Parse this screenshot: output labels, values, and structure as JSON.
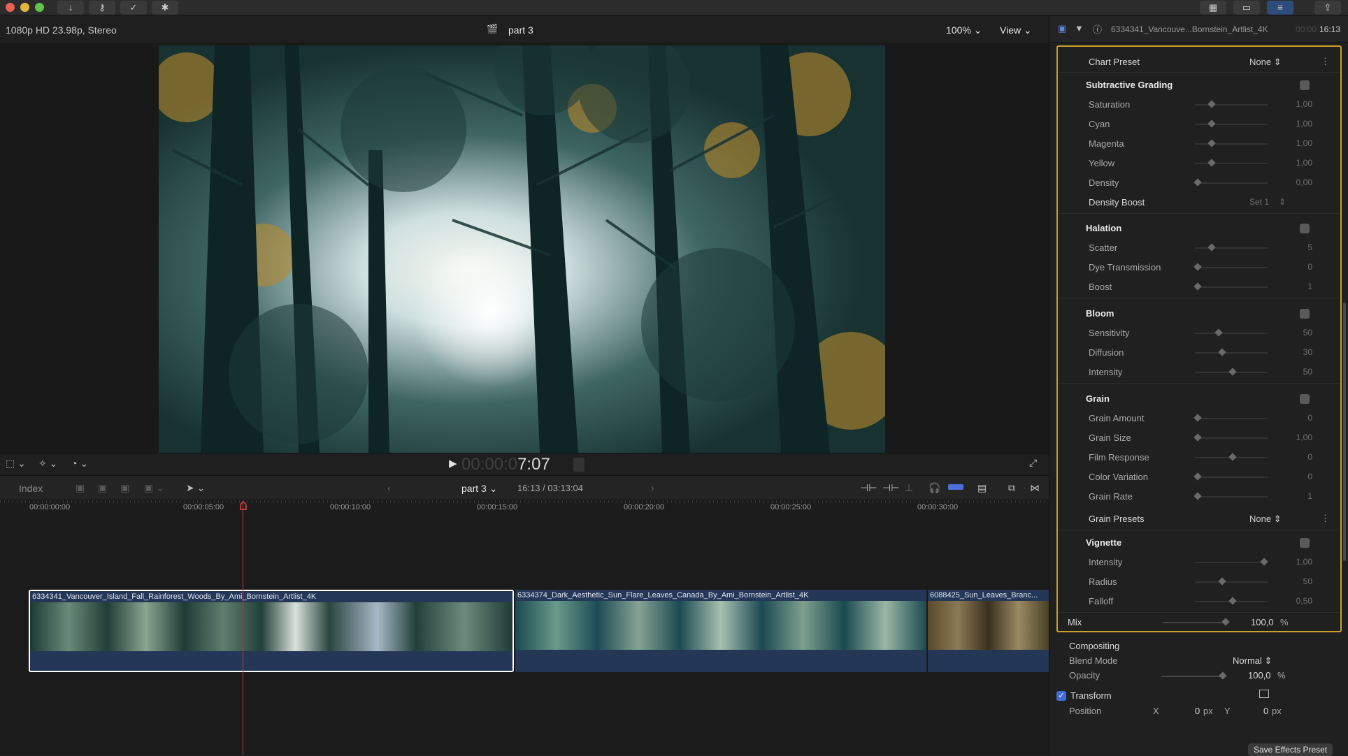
{
  "titlebar": {
    "icons": [
      "download-icon",
      "key-icon",
      "check-icon",
      "share-grid-icon"
    ],
    "right_icons": [
      "grid-view-icon",
      "filmstrip-icon",
      "inspector-toggle-icon",
      "export-icon"
    ]
  },
  "viewer": {
    "format": "1080p HD 23.98p, Stereo",
    "project": "part 3",
    "zoom": "100%",
    "view_label": "View"
  },
  "transport": {
    "timecode_dim": "00:00:0",
    "timecode_bright": "7:07"
  },
  "timeline_toolbar": {
    "index_label": "Index",
    "project": "part 3",
    "duration": "16:13 / 03:13:04"
  },
  "ruler": {
    "ticks": [
      "00:00:00:00",
      "00:00:05:00",
      "00:00:10:00",
      "00:00:15:00",
      "00:00:20:00",
      "00:00:25:00",
      "00:00:30:00"
    ]
  },
  "clips": [
    {
      "title": "6334341_Vancouver_Island_Fall_Rainforest_Woods_By_Ami_Bornstein_Artlist_4K",
      "selected": true
    },
    {
      "title": "6334374_Dark_Aesthetic_Sun_Flare_Leaves_Canada_By_Ami_Bornstein_Artlist_4K",
      "selected": false
    },
    {
      "title": "6088425_Sun_Leaves_Branc...",
      "selected": false
    }
  ],
  "inspector": {
    "clip_name": "6334341_Vancouve...Bornstein_Artlist_4K",
    "clip_time_dim": "00:00",
    "clip_time": "16:13",
    "chart_preset": {
      "label": "Chart Preset",
      "value": "None"
    },
    "subtractive": {
      "title": "Subtractive Grading",
      "params": [
        {
          "label": "Saturation",
          "value": "1,00",
          "level": 0.2
        },
        {
          "label": "Cyan",
          "value": "1,00",
          "level": 0.2
        },
        {
          "label": "Magenta",
          "value": "1,00",
          "level": 0.2
        },
        {
          "label": "Yellow",
          "value": "1,00",
          "level": 0.2
        },
        {
          "label": "Density",
          "value": "0,00",
          "level": 0.0
        }
      ],
      "density_boost": {
        "label": "Density Boost",
        "value": "Set 1"
      }
    },
    "halation": {
      "title": "Halation",
      "params": [
        {
          "label": "Scatter",
          "value": "5",
          "level": 0.2
        },
        {
          "label": "Dye Transmission",
          "value": "0",
          "level": 0.0
        },
        {
          "label": "Boost",
          "value": "1",
          "level": 0.0
        }
      ]
    },
    "bloom": {
      "title": "Bloom",
      "params": [
        {
          "label": "Sensitivity",
          "value": "50",
          "level": 0.3
        },
        {
          "label": "Diffusion",
          "value": "30",
          "level": 0.35
        },
        {
          "label": "Intensity",
          "value": "50",
          "level": 0.5
        }
      ]
    },
    "grain": {
      "title": "Grain",
      "params": [
        {
          "label": "Grain Amount",
          "value": "0",
          "level": 0.0
        },
        {
          "label": "Grain Size",
          "value": "1,00",
          "level": 0.0
        },
        {
          "label": "Film Response",
          "value": "0",
          "level": 0.5
        },
        {
          "label": "Color Variation",
          "value": "0",
          "level": 0.0
        },
        {
          "label": "Grain Rate",
          "value": "1",
          "level": 0.0
        }
      ],
      "presets": {
        "label": "Grain Presets",
        "value": "None"
      }
    },
    "vignette": {
      "title": "Vignette",
      "params": [
        {
          "label": "Intensity",
          "value": "1,00",
          "level": 0.95
        },
        {
          "label": "Radius",
          "value": "50",
          "level": 0.35
        },
        {
          "label": "Falloff",
          "value": "0,50",
          "level": 0.5
        }
      ]
    },
    "mix": {
      "label": "Mix",
      "value": "100,0",
      "unit": "%"
    },
    "compositing": {
      "title": "Compositing",
      "blend_label": "Blend Mode",
      "blend_value": "Normal",
      "opacity_label": "Opacity",
      "opacity_value": "100,0",
      "opacity_unit": "%"
    },
    "transform": {
      "title": "Transform",
      "position_label": "Position",
      "x_label": "X",
      "x_value": "0",
      "y_label": "Y",
      "y_value": "0",
      "unit": "px"
    },
    "save_preset": "Save Effects Preset"
  },
  "colors": {
    "accent_yellow": "#c9a227",
    "clip_blue": "#243757",
    "playhead": "#b43a3a"
  }
}
